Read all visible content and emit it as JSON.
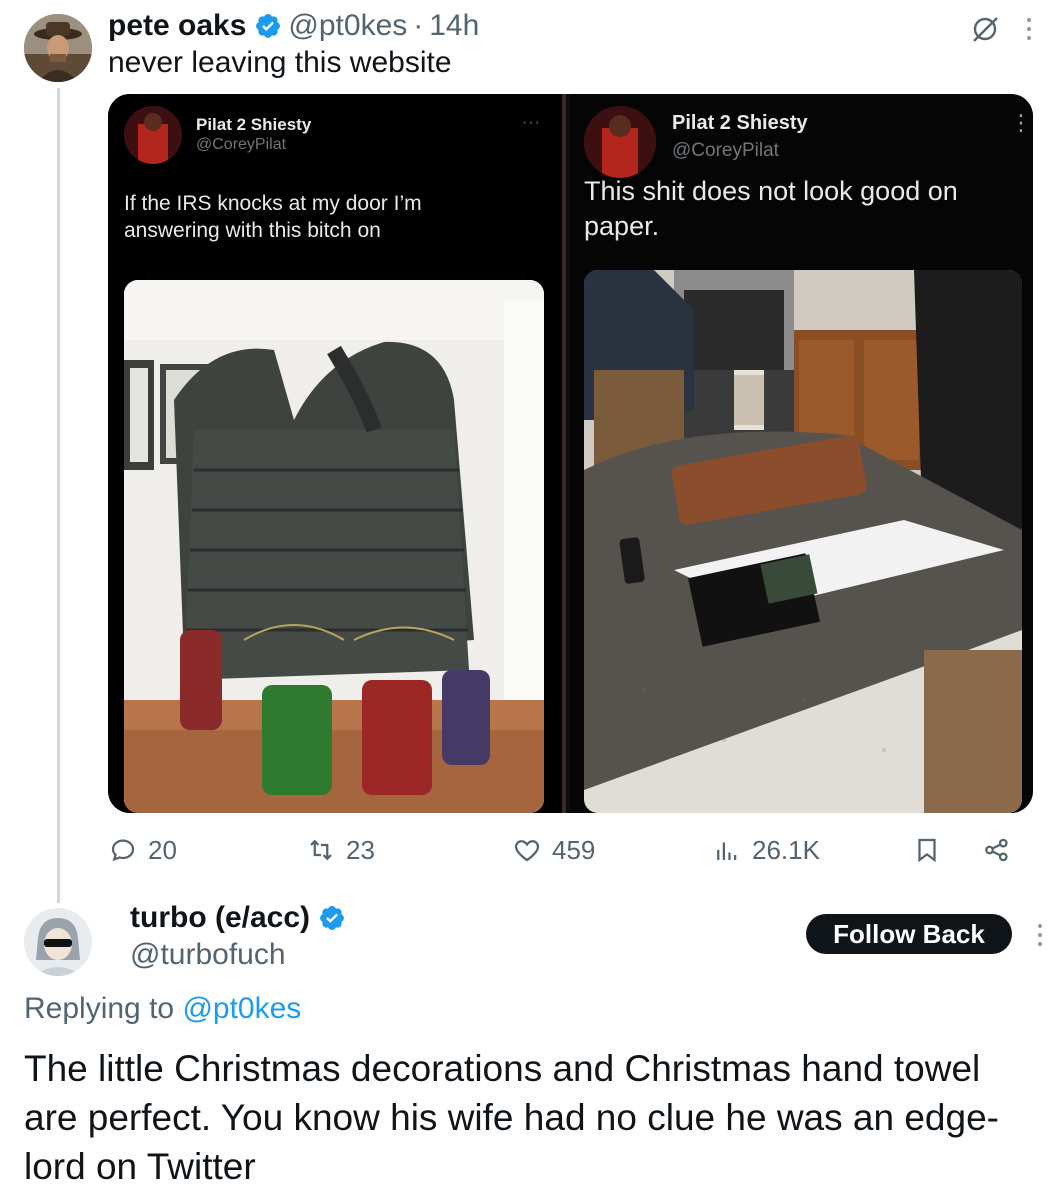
{
  "tweet": {
    "author_name": "pete oaks",
    "author_handle": "@pt0kes",
    "separator": "·",
    "time": "14h",
    "text": "never leaving this website",
    "verified": true
  },
  "embedded_left": {
    "name": "Pilat 2 Shiesty",
    "handle": "@CoreyPilat",
    "more": "···",
    "text": "If the IRS knocks at my door I’m answering with this bitch on",
    "image_desc": "tactical-vest-photo"
  },
  "embedded_right": {
    "name": "Pilat 2 Shiesty",
    "handle": "@CoreyPilat",
    "more": "⋮",
    "text": "This shit does not look good on paper.",
    "image_desc": "kitchen-counter-printout-photo"
  },
  "actions": {
    "replies": "20",
    "retweets": "23",
    "likes": "459",
    "views": "26.1K"
  },
  "reply": {
    "author_name": "turbo (e/acc)",
    "author_handle": "@turbofuch",
    "verified": true,
    "follow_label": "Follow Back",
    "replying_prefix": "Replying to",
    "replying_to": "@pt0kes",
    "text": "The little Christmas decorations and Christmas hand towel are perfect. You know his wife had no clue he was an edge-lord on Twitter"
  },
  "colors": {
    "text": "#0f1419",
    "secondary": "#536471",
    "link": "#1d9bf0",
    "verified": "#1d9bf0"
  },
  "icons": [
    "reply-icon",
    "retweet-icon",
    "like-icon",
    "views-icon",
    "bookmark-icon",
    "share-icon",
    "grok-icon",
    "more-icon",
    "verified-icon"
  ]
}
